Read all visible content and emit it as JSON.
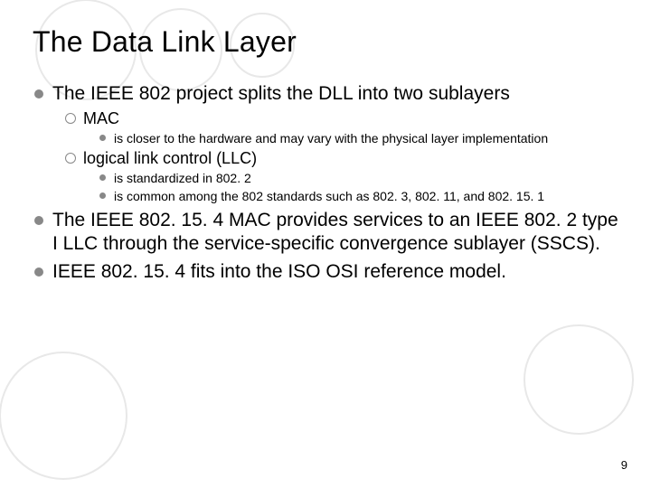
{
  "title": "The Data Link Layer",
  "bullets": {
    "b1": "The IEEE 802 project splits the DLL into two sublayers",
    "b1a": "MAC",
    "b1a1": "is closer to the hardware and may vary with the physical layer implementation",
    "b1b": "logical link control (LLC)",
    "b1b1": "is standardized in 802. 2",
    "b1b2": "is common among the 802 standards such as 802. 3, 802. 11, and 802. 15. 1",
    "b2": "The IEEE 802. 15. 4 MAC provides services to an IEEE 802. 2 type I LLC through the service-specific convergence sublayer (SSCS).",
    "b3": "IEEE 802. 15. 4 fits into the ISO OSI reference model."
  },
  "page_number": "9"
}
